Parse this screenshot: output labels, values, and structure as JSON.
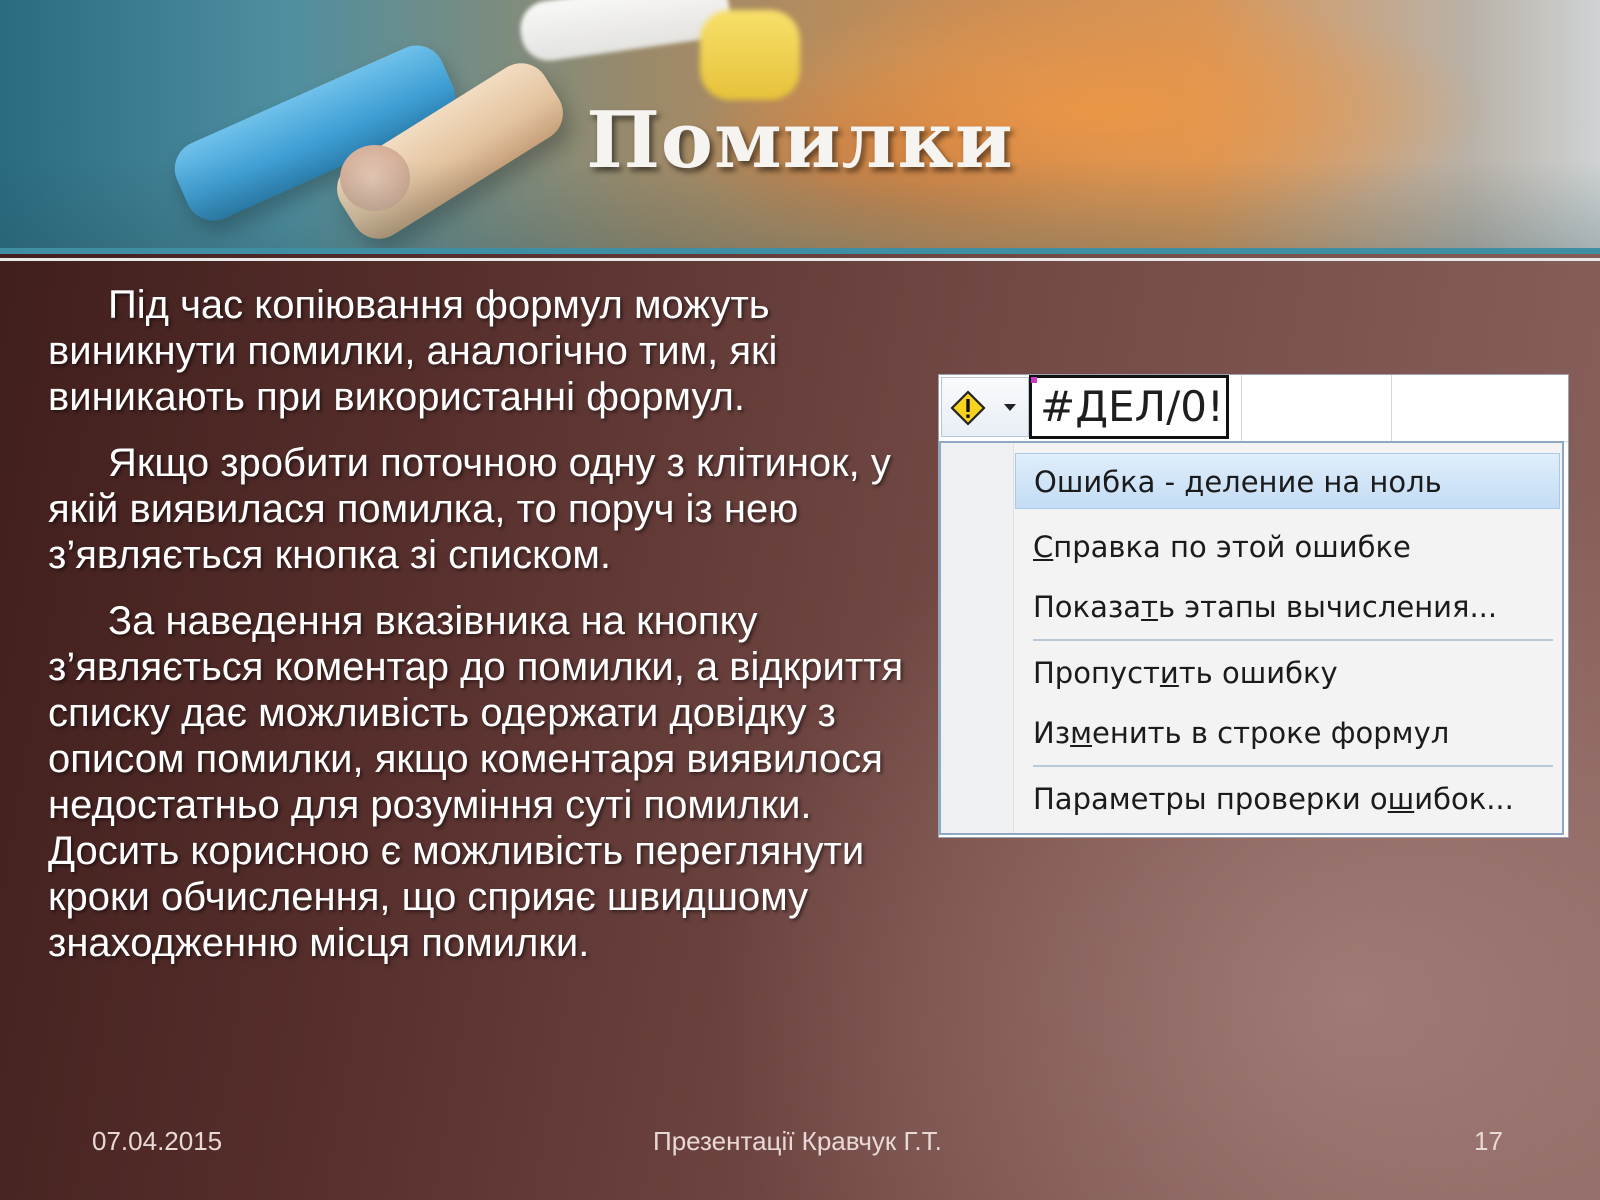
{
  "slide": {
    "title": "Помилки",
    "paragraphs": [
      "Під час копіювання формул можуть виникнути помилки, аналогічно тим, які виникають при використанні формул.",
      "Якщо зробити поточною одну з клітинок, у якій виявилася помилка, то поруч із нею з’являється кнопка зі списком.",
      "За наведення вказівника на кнопку з’являється коментар до помилки, а відкриття списку дає можливість одержати довідку з описом помилки, якщо коментаря виявилося недостатньо для розуміння суті помилки. Досить корисною є можливість переглянути кроки обчислення, що сприяє швидшому знаходженню місця помилки."
    ]
  },
  "screenshot": {
    "error_button_icon": "warning-icon",
    "cell_value": "#ДЕЛ/0!",
    "menu": {
      "header": "Ошибка  - деление на ноль",
      "items": [
        {
          "pre": "",
          "ul": "С",
          "post": "правка по этой ошибке"
        },
        {
          "pre": "Показа",
          "ul": "т",
          "post": "ь этапы вычисления..."
        },
        {
          "pre": "Пропуст",
          "ul": "и",
          "post": "ть ошибку"
        },
        {
          "pre": "Из",
          "ul": "м",
          "post": "енить в строке формул"
        },
        {
          "pre": "Параметры проверки о",
          "ul": "ш",
          "post": "ибок..."
        }
      ]
    }
  },
  "footer": {
    "date": "07.04.2015",
    "author": "Презентації Кравчук Г.Т.",
    "page": "17"
  },
  "colors": {
    "banner_line": "#3f8ea3",
    "highlight": "#c4dcf4"
  }
}
